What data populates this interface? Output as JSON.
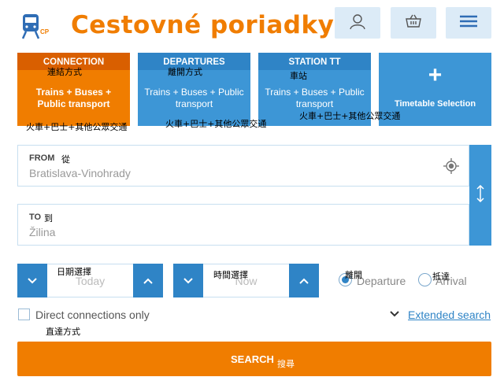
{
  "header": {
    "logo_mark": "CP",
    "title": "Cestovné poriadky",
    "icons": [
      "user-icon",
      "basket-icon",
      "menu-icon"
    ]
  },
  "tabs": [
    {
      "head": "CONNECTION",
      "body": "Trains + Buses + Public transport",
      "active": true
    },
    {
      "head": "DEPARTURES",
      "body": "Trains + Buses + Public transport",
      "active": false
    },
    {
      "head": "STATION TT",
      "body": "Trains + Buses + Public transport",
      "active": false
    },
    {
      "head": "+",
      "body": "Timetable Selection",
      "active": false
    }
  ],
  "from": {
    "label": "FROM",
    "value": "Bratislava-Vinohrady"
  },
  "to": {
    "label": "TO",
    "value": "Žilina"
  },
  "date": {
    "placeholder": "Today"
  },
  "time": {
    "placeholder": "Now"
  },
  "direction": {
    "departure": "Departure",
    "arrival": "Arrival",
    "selected": "departure"
  },
  "options": {
    "direct_only": "Direct connections only",
    "extended_search": "Extended search"
  },
  "search_label": "SEARCH",
  "overlays": {
    "connection": "連結方式",
    "departures": "離開方式",
    "station": "車站",
    "transport_1": "火車+巴士+其他公眾交通",
    "transport_2": "火車+巴士+其他公眾交通",
    "transport_3": "火車+巴士+其他公眾交通",
    "from": "從",
    "to": "到",
    "date": "日期選擇",
    "time": "時間選擇",
    "departure": "離開",
    "arrival": "抵達",
    "direct": "直達方式",
    "search": "搜尋"
  },
  "colors": {
    "orange": "#f07d00",
    "blue": "#3d96d6",
    "dark_blue": "#2f84c6"
  }
}
